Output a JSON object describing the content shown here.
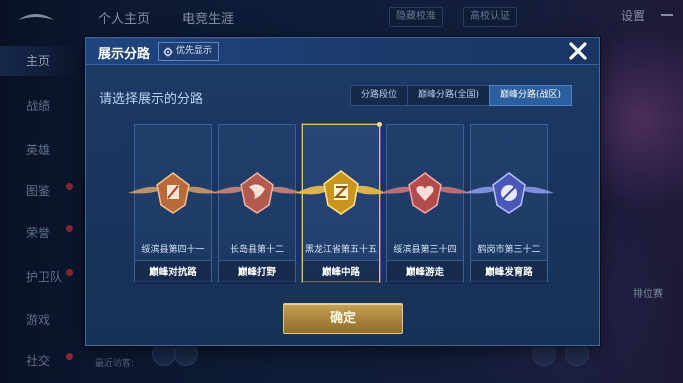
{
  "background": {
    "sidebar": [
      {
        "label": "主页",
        "active": true,
        "dot": false
      },
      {
        "label": "战绩",
        "active": false,
        "dot": false
      },
      {
        "label": "英雄",
        "active": false,
        "dot": false
      },
      {
        "label": "图鉴",
        "active": false,
        "dot": true
      },
      {
        "label": "荣誉",
        "active": false,
        "dot": true
      },
      {
        "label": "护卫队",
        "active": false,
        "dot": true
      },
      {
        "label": "游戏",
        "active": false,
        "dot": false
      },
      {
        "label": "社交",
        "active": false,
        "dot": true
      }
    ],
    "top_tabs": [
      "个人主页",
      "电竞生涯"
    ],
    "top_buttons": [
      "隐藏校准",
      "高校认证"
    ],
    "settings_label": "设置",
    "rank_label": "排位赛",
    "bottom_text": "最近访客:"
  },
  "modal": {
    "title": "展示分路",
    "priority_label": "优先显示",
    "subtitle": "请选择展示的分路",
    "tabs": [
      {
        "label": "分路段位",
        "active": false
      },
      {
        "label": "巅峰分路(全国)",
        "active": false
      },
      {
        "label": "巅峰分路(战区)",
        "active": true
      }
    ],
    "cards": [
      {
        "place": "绥滨县第四十一",
        "role": "巅峰对抗路",
        "icon": "sword-emblem-icon",
        "color": "#e08a4a",
        "selected": false
      },
      {
        "place": "长岛县第十二",
        "role": "巅峰打野",
        "icon": "wolf-emblem-icon",
        "color": "#e07a6a",
        "selected": false
      },
      {
        "place": "黑龙江省第五十五",
        "role": "巅峰中路",
        "icon": "magic-emblem-icon",
        "color": "#f2c14a",
        "selected": true
      },
      {
        "place": "绥滨县第三十四",
        "role": "巅峰游走",
        "icon": "heart-emblem-icon",
        "color": "#e06a6a",
        "selected": false
      },
      {
        "place": "鹤岗市第三十二",
        "role": "巅峰发育路",
        "icon": "target-emblem-icon",
        "color": "#7f90f0",
        "selected": false
      }
    ],
    "confirm_label": "确定"
  },
  "colors": {
    "accent_gold": "#c6a357",
    "tab_active": "#2d5f9e",
    "modal_bg": "#1b3a66"
  }
}
